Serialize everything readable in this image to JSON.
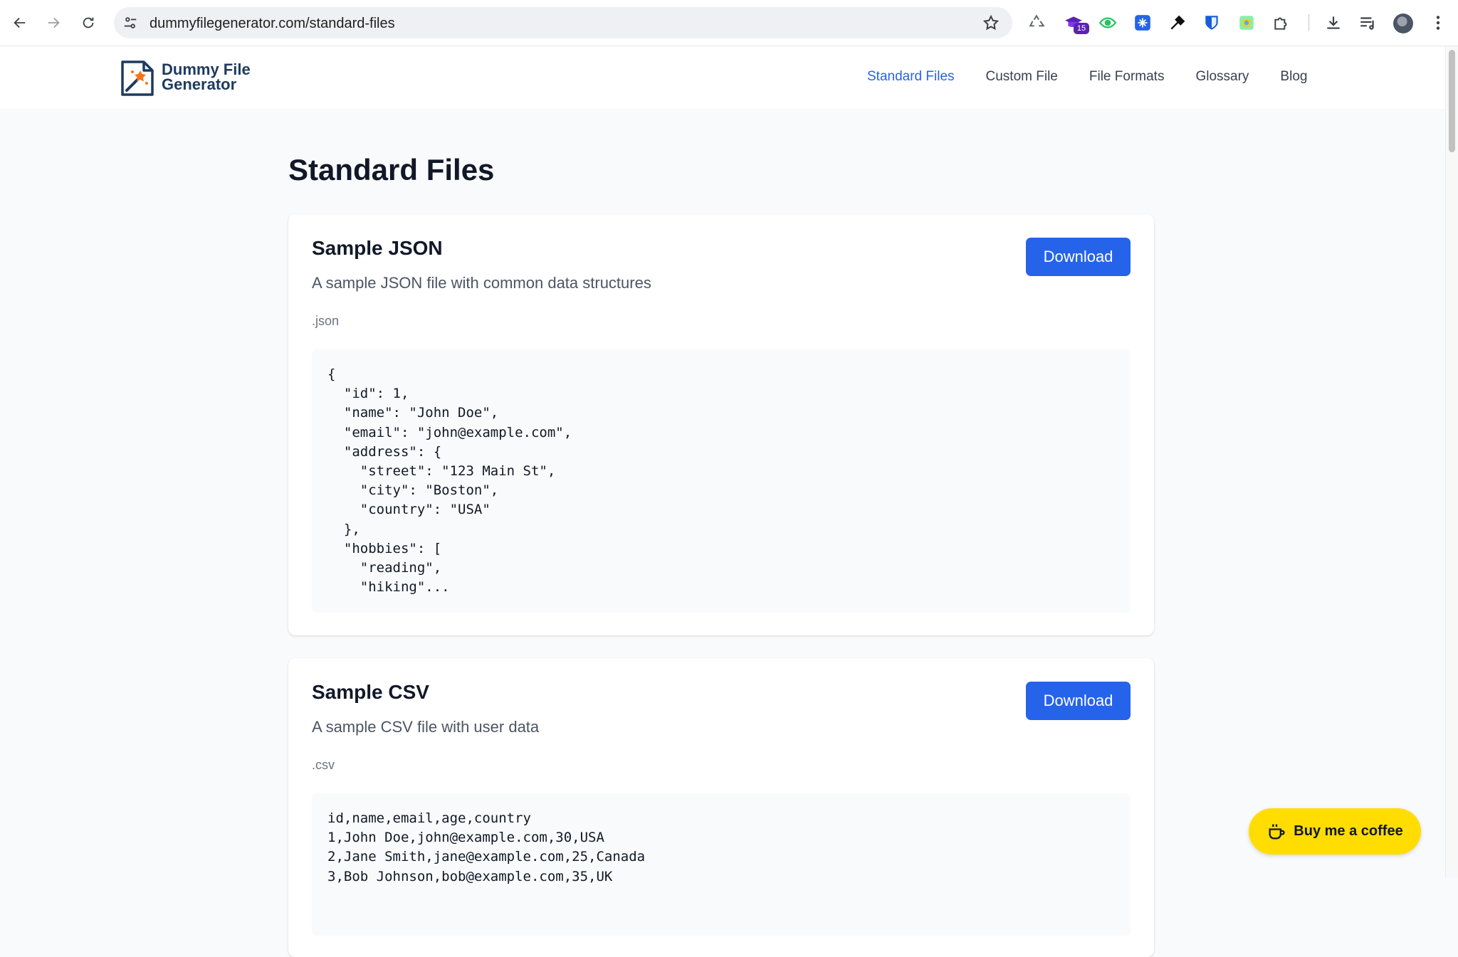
{
  "browser": {
    "url": "dummyfilegenerator.com/standard-files",
    "extension_badge": "15"
  },
  "site": {
    "logo_line1": "Dummy File",
    "logo_line2": "Generator",
    "nav": [
      {
        "label": "Standard Files",
        "active": true
      },
      {
        "label": "Custom File",
        "active": false
      },
      {
        "label": "File Formats",
        "active": false
      },
      {
        "label": "Glossary",
        "active": false
      },
      {
        "label": "Blog",
        "active": false
      }
    ]
  },
  "page": {
    "title": "Standard Files",
    "cards": [
      {
        "title": "Sample JSON",
        "description": "A sample JSON file with common data structures",
        "extension": ".json",
        "button_label": "Download",
        "code": "{\n  \"id\": 1,\n  \"name\": \"John Doe\",\n  \"email\": \"john@example.com\",\n  \"address\": {\n    \"street\": \"123 Main St\",\n    \"city\": \"Boston\",\n    \"country\": \"USA\"\n  },\n  \"hobbies\": [\n    \"reading\",\n    \"hiking\"..."
      },
      {
        "title": "Sample CSV",
        "description": "A sample CSV file with user data",
        "extension": ".csv",
        "button_label": "Download",
        "code": "id,name,email,age,country\n1,John Doe,john@example.com,30,USA\n2,Jane Smith,jane@example.com,25,Canada\n3,Bob Johnson,bob@example.com,35,UK"
      }
    ]
  },
  "coffee_button": {
    "label": "Buy me a coffee"
  },
  "colors": {
    "accent": "#2563eb",
    "coffee": "#ffdd00"
  },
  "icons": [
    "back-arrow-icon",
    "forward-arrow-icon",
    "reload-icon",
    "site-settings-icon",
    "bookmark-star-icon",
    "recycle-extension-icon",
    "graduation-cap-extension-icon",
    "eye-extension-icon",
    "snowflake-extension-icon",
    "eyedropper-extension-icon",
    "shield-extension-icon",
    "image-extension-icon",
    "puzzle-extensions-icon",
    "download-icon",
    "reading-list-icon",
    "profile-avatar",
    "more-menu-icon",
    "coffee-cup-icon"
  ]
}
